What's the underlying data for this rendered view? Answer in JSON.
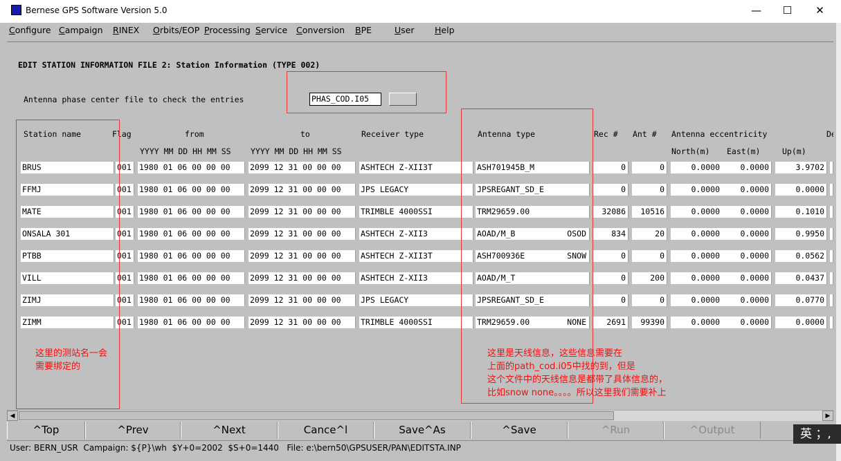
{
  "window": {
    "title": "Bernese GPS Software Version 5.0",
    "minimize": "—",
    "maximize": "☐",
    "close": "✕"
  },
  "menu": [
    "Configure",
    "Campaign",
    "RINEX",
    "Orbits/EOP",
    "Processing",
    "Service",
    "Conversion",
    "BPE",
    "User",
    "Help"
  ],
  "panel": {
    "heading": "EDIT STATION INFORMATION FILE 2: Station Information (TYPE 002)",
    "phase_label": "Antenna phase center file to check the entries",
    "phase_value": "PHAS_COD.I05"
  },
  "headers": {
    "station": "Station name",
    "flag": "Flag",
    "from": "from",
    "to": "to",
    "date_fmt": "YYYY MM DD HH MM SS",
    "receiver": "Receiver type",
    "antenna": "Antenna type",
    "rec_no": "Rec #",
    "ant_no": "Ant #",
    "ecc": "Antenna eccentricity",
    "north": "North(m)",
    "east": "East(m)",
    "up": "Up(m)",
    "desc": "De"
  },
  "rows": [
    {
      "station": "BRUS",
      "flag": "001",
      "from": "1980 01 06 00 00 00",
      "to": "2099 12 31 00 00 00",
      "receiver": "ASHTECH Z-XII3T",
      "antenna": "ASH701945B_M",
      "radome": "",
      "rec": "0",
      "ant": "0",
      "north": "0.0000",
      "east": "0.0000",
      "up": "3.9702"
    },
    {
      "station": "FFMJ",
      "flag": "001",
      "from": "1980 01 06 00 00 00",
      "to": "2099 12 31 00 00 00",
      "receiver": "JPS LEGACY",
      "antenna": "JPSREGANT_SD_E",
      "radome": "",
      "rec": "0",
      "ant": "0",
      "north": "0.0000",
      "east": "0.0000",
      "up": "0.0000"
    },
    {
      "station": "MATE",
      "flag": "001",
      "from": "1980 01 06 00 00 00",
      "to": "2099 12 31 00 00 00",
      "receiver": "TRIMBLE 4000SSI",
      "antenna": "TRM29659.00",
      "radome": "",
      "rec": "32086",
      "ant": "10516",
      "north": "0.0000",
      "east": "0.0000",
      "up": "0.1010"
    },
    {
      "station": "ONSALA 301",
      "flag": "001",
      "from": "1980 01 06 00 00 00",
      "to": "2099 12 31 00 00 00",
      "receiver": "ASHTECH Z-XII3",
      "antenna": "AOAD/M_B",
      "radome": "OSOD",
      "rec": "834",
      "ant": "20",
      "north": "0.0000",
      "east": "0.0000",
      "up": "0.9950"
    },
    {
      "station": "PTBB",
      "flag": "001",
      "from": "1980 01 06 00 00 00",
      "to": "2099 12 31 00 00 00",
      "receiver": "ASHTECH Z-XII3T",
      "antenna": "ASH700936E",
      "radome": "SNOW",
      "rec": "0",
      "ant": "0",
      "north": "0.0000",
      "east": "0.0000",
      "up": "0.0562"
    },
    {
      "station": "VILL",
      "flag": "001",
      "from": "1980 01 06 00 00 00",
      "to": "2099 12 31 00 00 00",
      "receiver": "ASHTECH Z-XII3",
      "antenna": "AOAD/M_T",
      "radome": "",
      "rec": "0",
      "ant": "200",
      "north": "0.0000",
      "east": "0.0000",
      "up": "0.0437"
    },
    {
      "station": "ZIMJ",
      "flag": "001",
      "from": "1980 01 06 00 00 00",
      "to": "2099 12 31 00 00 00",
      "receiver": "JPS LEGACY",
      "antenna": "JPSREGANT_SD_E",
      "radome": "",
      "rec": "0",
      "ant": "0",
      "north": "0.0000",
      "east": "0.0000",
      "up": "0.0770"
    },
    {
      "station": "ZIMM",
      "flag": "001",
      "from": "1980 01 06 00 00 00",
      "to": "2099 12 31 00 00 00",
      "receiver": "TRIMBLE 4000SSI",
      "antenna": "TRM29659.00",
      "radome": "NONE",
      "rec": "2691",
      "ant": "99390",
      "north": "0.0000",
      "east": "0.0000",
      "up": "0.0000"
    }
  ],
  "annotations": {
    "station_note": [
      "这里的测站名一会",
      "需要绑定的"
    ],
    "antenna_note": [
      "这里是天线信息，这些信息需要在",
      "上面的path_cod.i05中找的到，但是",
      "这个文件中的天线信息是都带了具体信息的，",
      "比如snow none。。。。所以这里我们需要补上"
    ]
  },
  "buttons": [
    {
      "label": "^Top",
      "disabled": false
    },
    {
      "label": "^Prev",
      "disabled": false
    },
    {
      "label": "^Next",
      "disabled": false
    },
    {
      "label": "Cance^l",
      "disabled": false
    },
    {
      "label": "Save^As",
      "disabled": false
    },
    {
      "label": "^Save",
      "disabled": false
    },
    {
      "label": "^Run",
      "disabled": true
    },
    {
      "label": "^Output",
      "disabled": true
    }
  ],
  "status": "User: BERN_USR  Campaign: ${P}\\wh  $Y+0=2002  $S+0=1440   File: e:\\bern50\\GPSUSER/PAN\\EDITSTA.INP",
  "ime": "英 ；,"
}
